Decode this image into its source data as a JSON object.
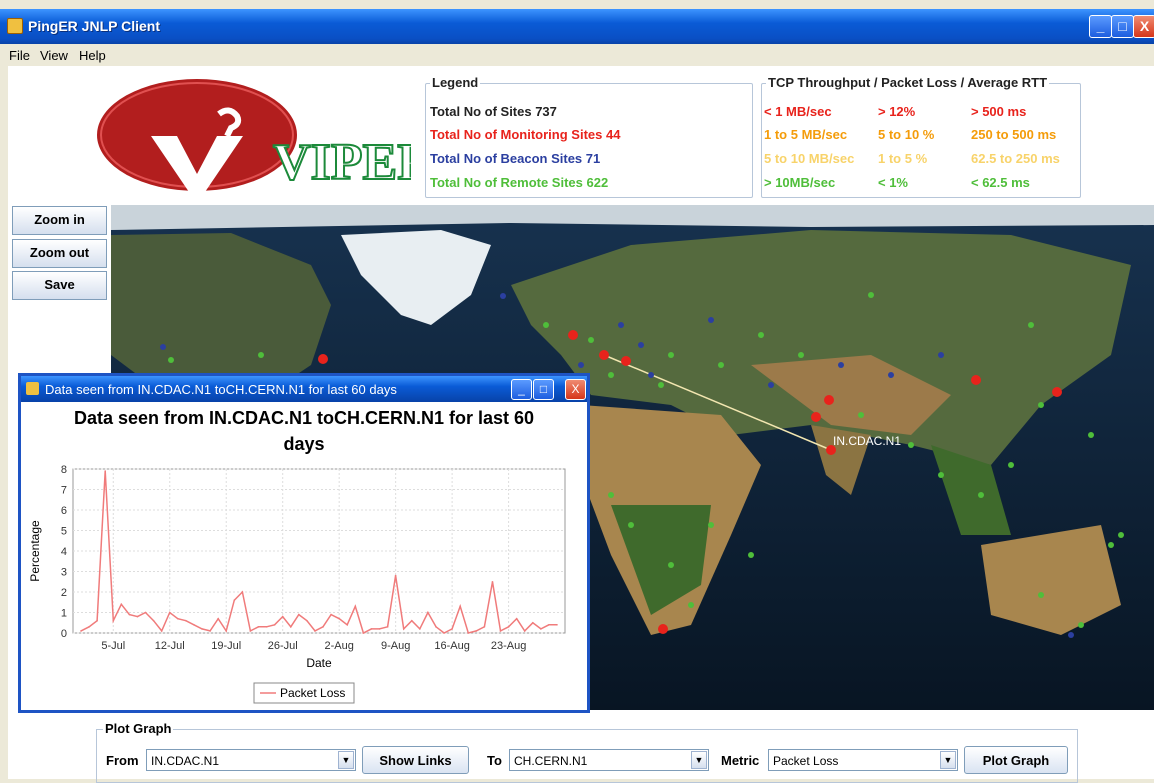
{
  "window": {
    "title": "PingER JNLP Client",
    "minimize": "_",
    "maximize": "□",
    "close": "X"
  },
  "menu": [
    "File",
    "View",
    "Help"
  ],
  "logo": {
    "text": "VIPER"
  },
  "legend": {
    "title": "Legend",
    "total_sites": "Total No of Sites 737",
    "monitoring_sites": "Total No of Monitoring Sites 44",
    "beacon_sites": "Total No of Beacon Sites 71",
    "remote_sites": "Total No of Remote Sites 622"
  },
  "tcp_legend": {
    "title": "TCP Throughput / Packet Loss / Average RTT",
    "rows": [
      [
        "< 1 MB/sec",
        "> 12%",
        "> 500 ms"
      ],
      [
        "1 to 5 MB/sec",
        "5 to 10 %",
        "250 to 500 ms"
      ],
      [
        "5 to 10 MB/sec",
        "1 to 5 %",
        "62.5 to 250 ms"
      ],
      [
        "> 10MB/sec",
        "< 1%",
        "< 62.5 ms"
      ]
    ],
    "colors": [
      "#e8231c",
      "#f49c0a",
      "#f8d36a",
      "#4fbe3a"
    ]
  },
  "side_buttons": {
    "zoom_in": "Zoom in",
    "zoom_out": "Zoom out",
    "save": "Save"
  },
  "map": {
    "site_label": "IN.CDAC.N1"
  },
  "chart_window": {
    "title": "Data seen from IN.CDAC.N1 toCH.CERN.N1 for last 60 days",
    "heading_line1": "Data seen from IN.CDAC.N1 toCH.CERN.N1 for last 60",
    "heading_line2": "days"
  },
  "chart_data": {
    "type": "line",
    "xlabel": "Date",
    "ylabel": "Percentage",
    "ylim": [
      0,
      8
    ],
    "x_ticks": [
      "5-Jul",
      "12-Jul",
      "19-Jul",
      "26-Jul",
      "2-Aug",
      "9-Aug",
      "16-Aug",
      "23-Aug"
    ],
    "y_ticks": [
      "0",
      "1",
      "2",
      "3",
      "4",
      "5",
      "6",
      "7",
      "8"
    ],
    "legend": "top-bottom-center",
    "series": [
      {
        "name": "Packet Loss",
        "color": "#f07b7b",
        "x": [
          "1-Jul",
          "2-Jul",
          "3-Jul",
          "4-Jul",
          "5-Jul",
          "6-Jul",
          "7-Jul",
          "8-Jul",
          "9-Jul",
          "10-Jul",
          "11-Jul",
          "12-Jul",
          "13-Jul",
          "14-Jul",
          "15-Jul",
          "16-Jul",
          "17-Jul",
          "18-Jul",
          "19-Jul",
          "20-Jul",
          "21-Jul",
          "22-Jul",
          "23-Jul",
          "24-Jul",
          "25-Jul",
          "26-Jul",
          "27-Jul",
          "28-Jul",
          "29-Jul",
          "30-Jul",
          "31-Jul",
          "1-Aug",
          "2-Aug",
          "3-Aug",
          "4-Aug",
          "5-Aug",
          "6-Aug",
          "7-Aug",
          "8-Aug",
          "9-Aug",
          "10-Aug",
          "11-Aug",
          "12-Aug",
          "13-Aug",
          "14-Aug",
          "15-Aug",
          "16-Aug",
          "17-Aug",
          "18-Aug",
          "19-Aug",
          "20-Aug",
          "21-Aug",
          "22-Aug",
          "23-Aug",
          "24-Aug",
          "25-Aug",
          "26-Aug",
          "27-Aug",
          "28-Aug",
          "29-Aug"
        ],
        "values": [
          0.1,
          0.3,
          0.6,
          7.9,
          0.6,
          1.4,
          0.9,
          0.8,
          1.0,
          0.6,
          0.1,
          1.0,
          0.7,
          0.6,
          0.4,
          0.2,
          0.1,
          0.7,
          0.1,
          1.6,
          2.0,
          0.1,
          0.3,
          0.3,
          0.4,
          0.8,
          0.3,
          0.9,
          0.6,
          0.1,
          0.3,
          0.9,
          0.7,
          0.4,
          1.3,
          0.0,
          0.2,
          0.2,
          0.3,
          2.8,
          0.2,
          0.6,
          0.2,
          1.0,
          0.3,
          0.0,
          0.2,
          1.3,
          0.0,
          0.1,
          0.3,
          2.5,
          0.1,
          0.3,
          0.7,
          0.1,
          0.5,
          0.2,
          0.4,
          0.4
        ]
      }
    ]
  },
  "plot_graph": {
    "title": "Plot Graph",
    "from_label": "From",
    "from_value": "IN.CDAC.N1",
    "show_links": "Show Links",
    "to_label": "To",
    "to_value": "CH.CERN.N1",
    "metric_label": "Metric",
    "metric_value": "Packet Loss",
    "plot_button": "Plot Graph"
  }
}
